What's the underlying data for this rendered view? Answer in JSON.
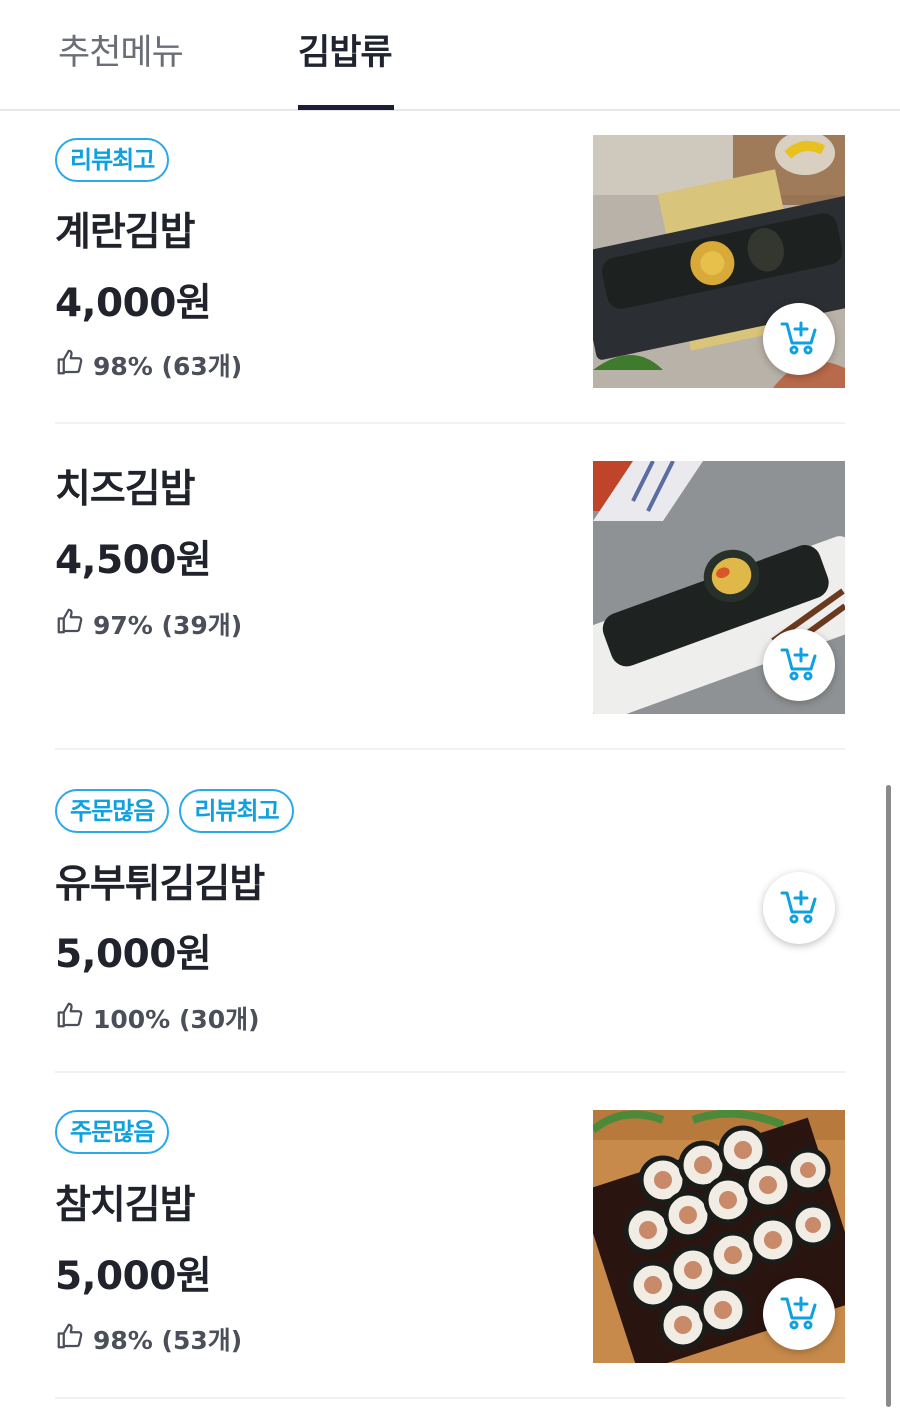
{
  "tabs": [
    {
      "label": "추천메뉴",
      "active": false
    },
    {
      "label": "김밥류",
      "active": true
    }
  ],
  "colors": {
    "accent": "#0fa0e0",
    "tab_indicator": "#1b1e34"
  },
  "menu_items": [
    {
      "badges": [
        "리뷰최고"
      ],
      "name": "계란김밥",
      "price": "4,000원",
      "rating": "98% (63개)",
      "has_image": true,
      "image": "egg-gimbap-photo"
    },
    {
      "badges": [],
      "name": "치즈김밥",
      "price": "4,500원",
      "rating": "97% (39개)",
      "has_image": true,
      "image": "cheese-gimbap-photo"
    },
    {
      "badges": [
        "주문많음",
        "리뷰최고"
      ],
      "name": "유부튀김김밥",
      "price": "5,000원",
      "rating": "100% (30개)",
      "has_image": false
    },
    {
      "badges": [
        "주문많음"
      ],
      "name": "참치김밥",
      "price": "5,000원",
      "rating": "98% (53개)",
      "has_image": true,
      "image": "tuna-gimbap-photo"
    }
  ],
  "icons": {
    "rating": "thumbs-up-icon",
    "cart": "add-to-cart-icon"
  }
}
